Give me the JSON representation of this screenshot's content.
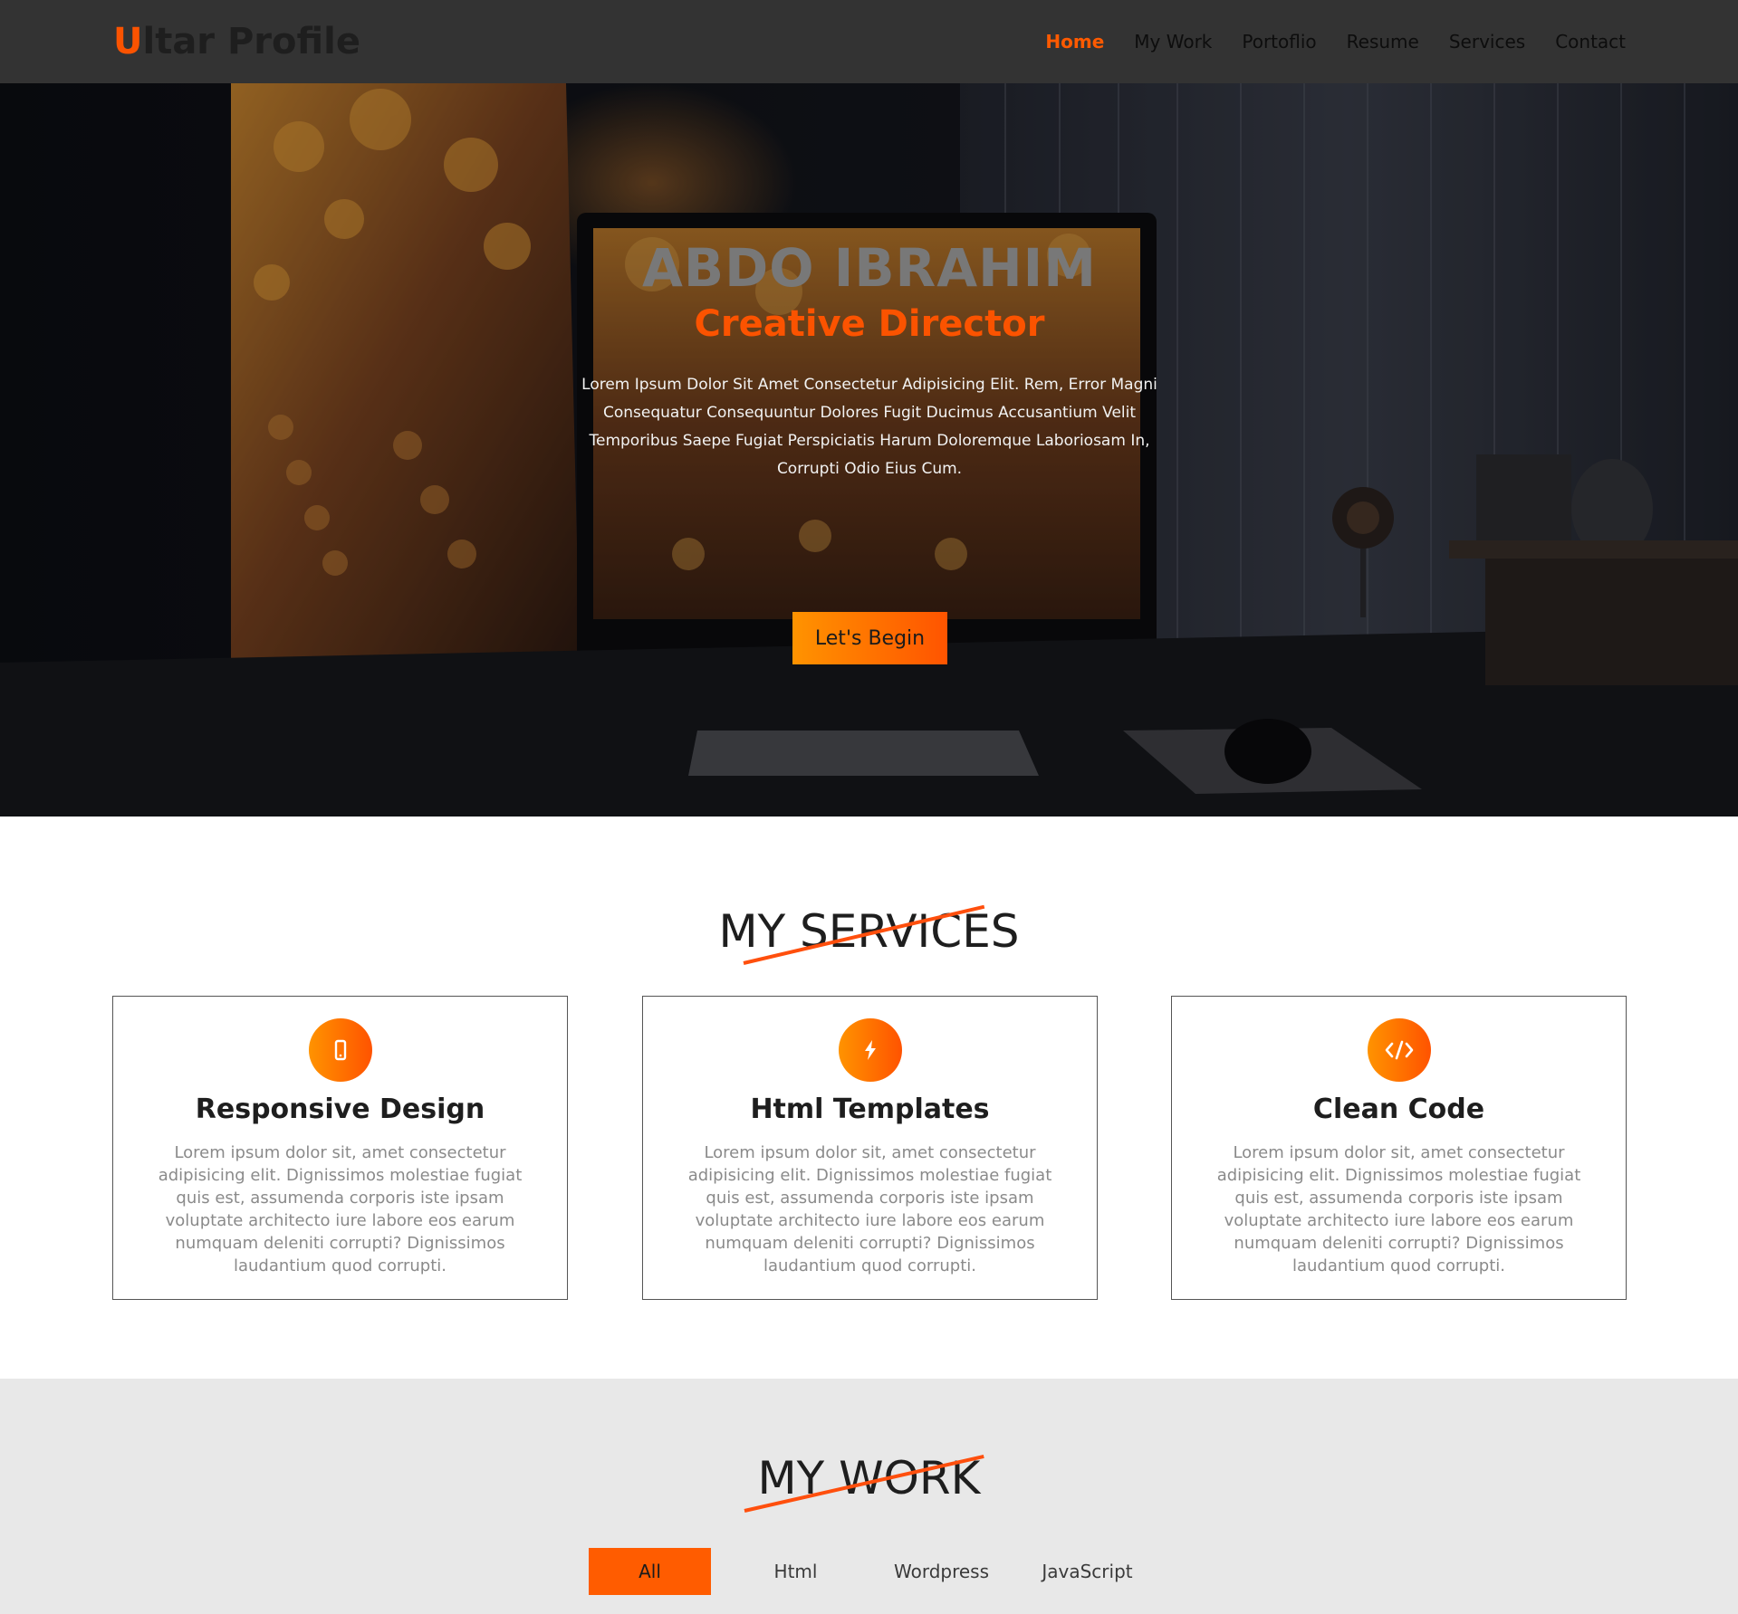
{
  "brand": {
    "initial": "U",
    "rest": "ltar Profile"
  },
  "nav": {
    "items": [
      "Home",
      "My Work",
      "Portoflio",
      "Resume",
      "Services",
      "Contact"
    ],
    "active": "Home"
  },
  "hero": {
    "name": "ABDO IBRAHIM",
    "role": "Creative Director",
    "description": "Lorem Ipsum Dolor Sit Amet Consectetur Adipisicing Elit. Rem, Error Magni Consequatur Consequuntur Dolores Fugit Ducimus Accusantium Velit Temporibus Saepe Fugiat Perspiciatis Harum Doloremque Laboriosam In, Corrupti Odio Eius Cum.",
    "button": "Let's Begin"
  },
  "services": {
    "title": "MY SERVICES",
    "cards": [
      {
        "icon": "mobile-icon",
        "title": "Responsive Design",
        "text": "Lorem ipsum dolor sit, amet consectetur adipisicing elit. Dignissimos molestiae fugiat quis est, assumenda corporis iste ipsam voluptate architecto iure labore eos earum numquam deleniti corrupti? Dignissimos laudantium quod corrupti."
      },
      {
        "icon": "bolt-icon",
        "title": "Html Templates",
        "text": "Lorem ipsum dolor sit, amet consectetur adipisicing elit. Dignissimos molestiae fugiat quis est, assumenda corporis iste ipsam voluptate architecto iure labore eos earum numquam deleniti corrupti? Dignissimos laudantium quod corrupti."
      },
      {
        "icon": "code-icon",
        "title": "Clean Code",
        "text": "Lorem ipsum dolor sit, amet consectetur adipisicing elit. Dignissimos molestiae fugiat quis est, assumenda corporis iste ipsam voluptate architecto iure labore eos earum numquam deleniti corrupti? Dignissimos laudantium quod corrupti."
      }
    ]
  },
  "work": {
    "title": "MY WORK",
    "filters": [
      "All",
      "Html",
      "Wordpress",
      "JavaScript"
    ],
    "active_filter": "All"
  },
  "colors": {
    "accent": "#ff5a00",
    "gradient_start": "#ff9300",
    "gradient_end": "#ff5300",
    "navbar": "#333333",
    "work_bg": "#e8e8e8"
  }
}
